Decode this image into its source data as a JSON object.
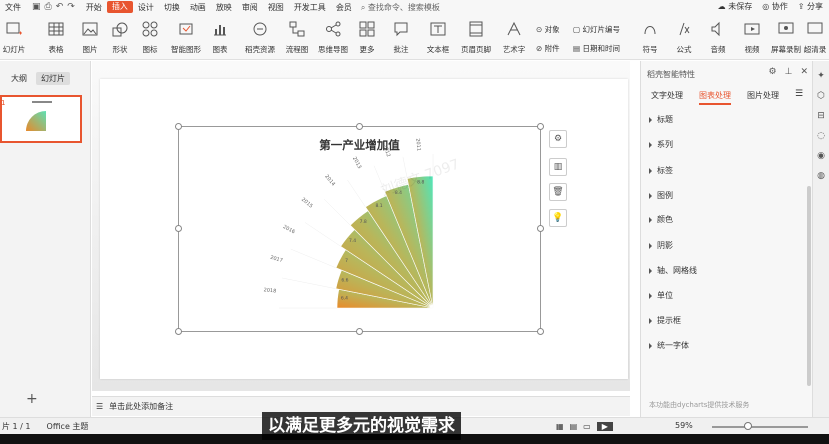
{
  "menubar": {
    "file": "文件",
    "items": [
      "开始",
      "插入",
      "设计",
      "切换",
      "动画",
      "放映",
      "审阅",
      "视图",
      "开发工具",
      "会员"
    ],
    "active_index": 1,
    "search": "查找命令、搜索模板",
    "unsaved": "未保存",
    "collab": "协作",
    "share": "分享"
  },
  "ribbon": {
    "new_slide": "幻灯片",
    "table": "表格",
    "picture": "图片",
    "shape": "形状",
    "icon": "图标",
    "smart_graphic": "智能图形",
    "chart": "图表",
    "docer": "稻壳资源",
    "flowchart": "流程图",
    "mindmap": "思维导图",
    "more": "更多",
    "comment": "批注",
    "textbox": "文本框",
    "header_footer": "页眉页脚",
    "wordart": "艺术字",
    "object": "对象",
    "slide_number": "幻灯片编号",
    "attachment": "附件",
    "datetime": "日期和时间",
    "symbol": "符号",
    "formula": "公式",
    "audio": "音频",
    "video": "视频",
    "screen_record": "屏幕录制",
    "super_record": "超清录"
  },
  "leftpane": {
    "tab_outline": "大纲",
    "tab_slides": "幻灯片",
    "slide_num": "1"
  },
  "chart": {
    "title": "第一产业增加值",
    "watermark": "刘德文 7097"
  },
  "chart_data": {
    "type": "bar",
    "title": "第一产业增加值",
    "categories": [
      "2018",
      "2017",
      "2016",
      "2015",
      "2014",
      "2013",
      "2012",
      "2011"
    ],
    "values": [
      6.4,
      6.6,
      7.0,
      7.4,
      7.8,
      8.1,
      8.4,
      8.8
    ],
    "ylim": [
      0,
      10
    ],
    "legend": "none"
  },
  "notes": {
    "placeholder": "单击此处添加备注"
  },
  "rightpanel": {
    "title": "稻壳智能特性",
    "tabs": [
      "文字处理",
      "图表处理",
      "图片处理"
    ],
    "active_tab": 1,
    "sections": [
      "标题",
      "系列",
      "标签",
      "图例",
      "颜色",
      "阴影",
      "轴、网格线",
      "单位",
      "提示框",
      "统一字体"
    ],
    "footer": "本功能由dycharts提供技术服务"
  },
  "status": {
    "slide": "片 1 / 1",
    "theme": "Office 主题",
    "zoom": "59%",
    "caption": "以满足更多元的视觉需求"
  }
}
